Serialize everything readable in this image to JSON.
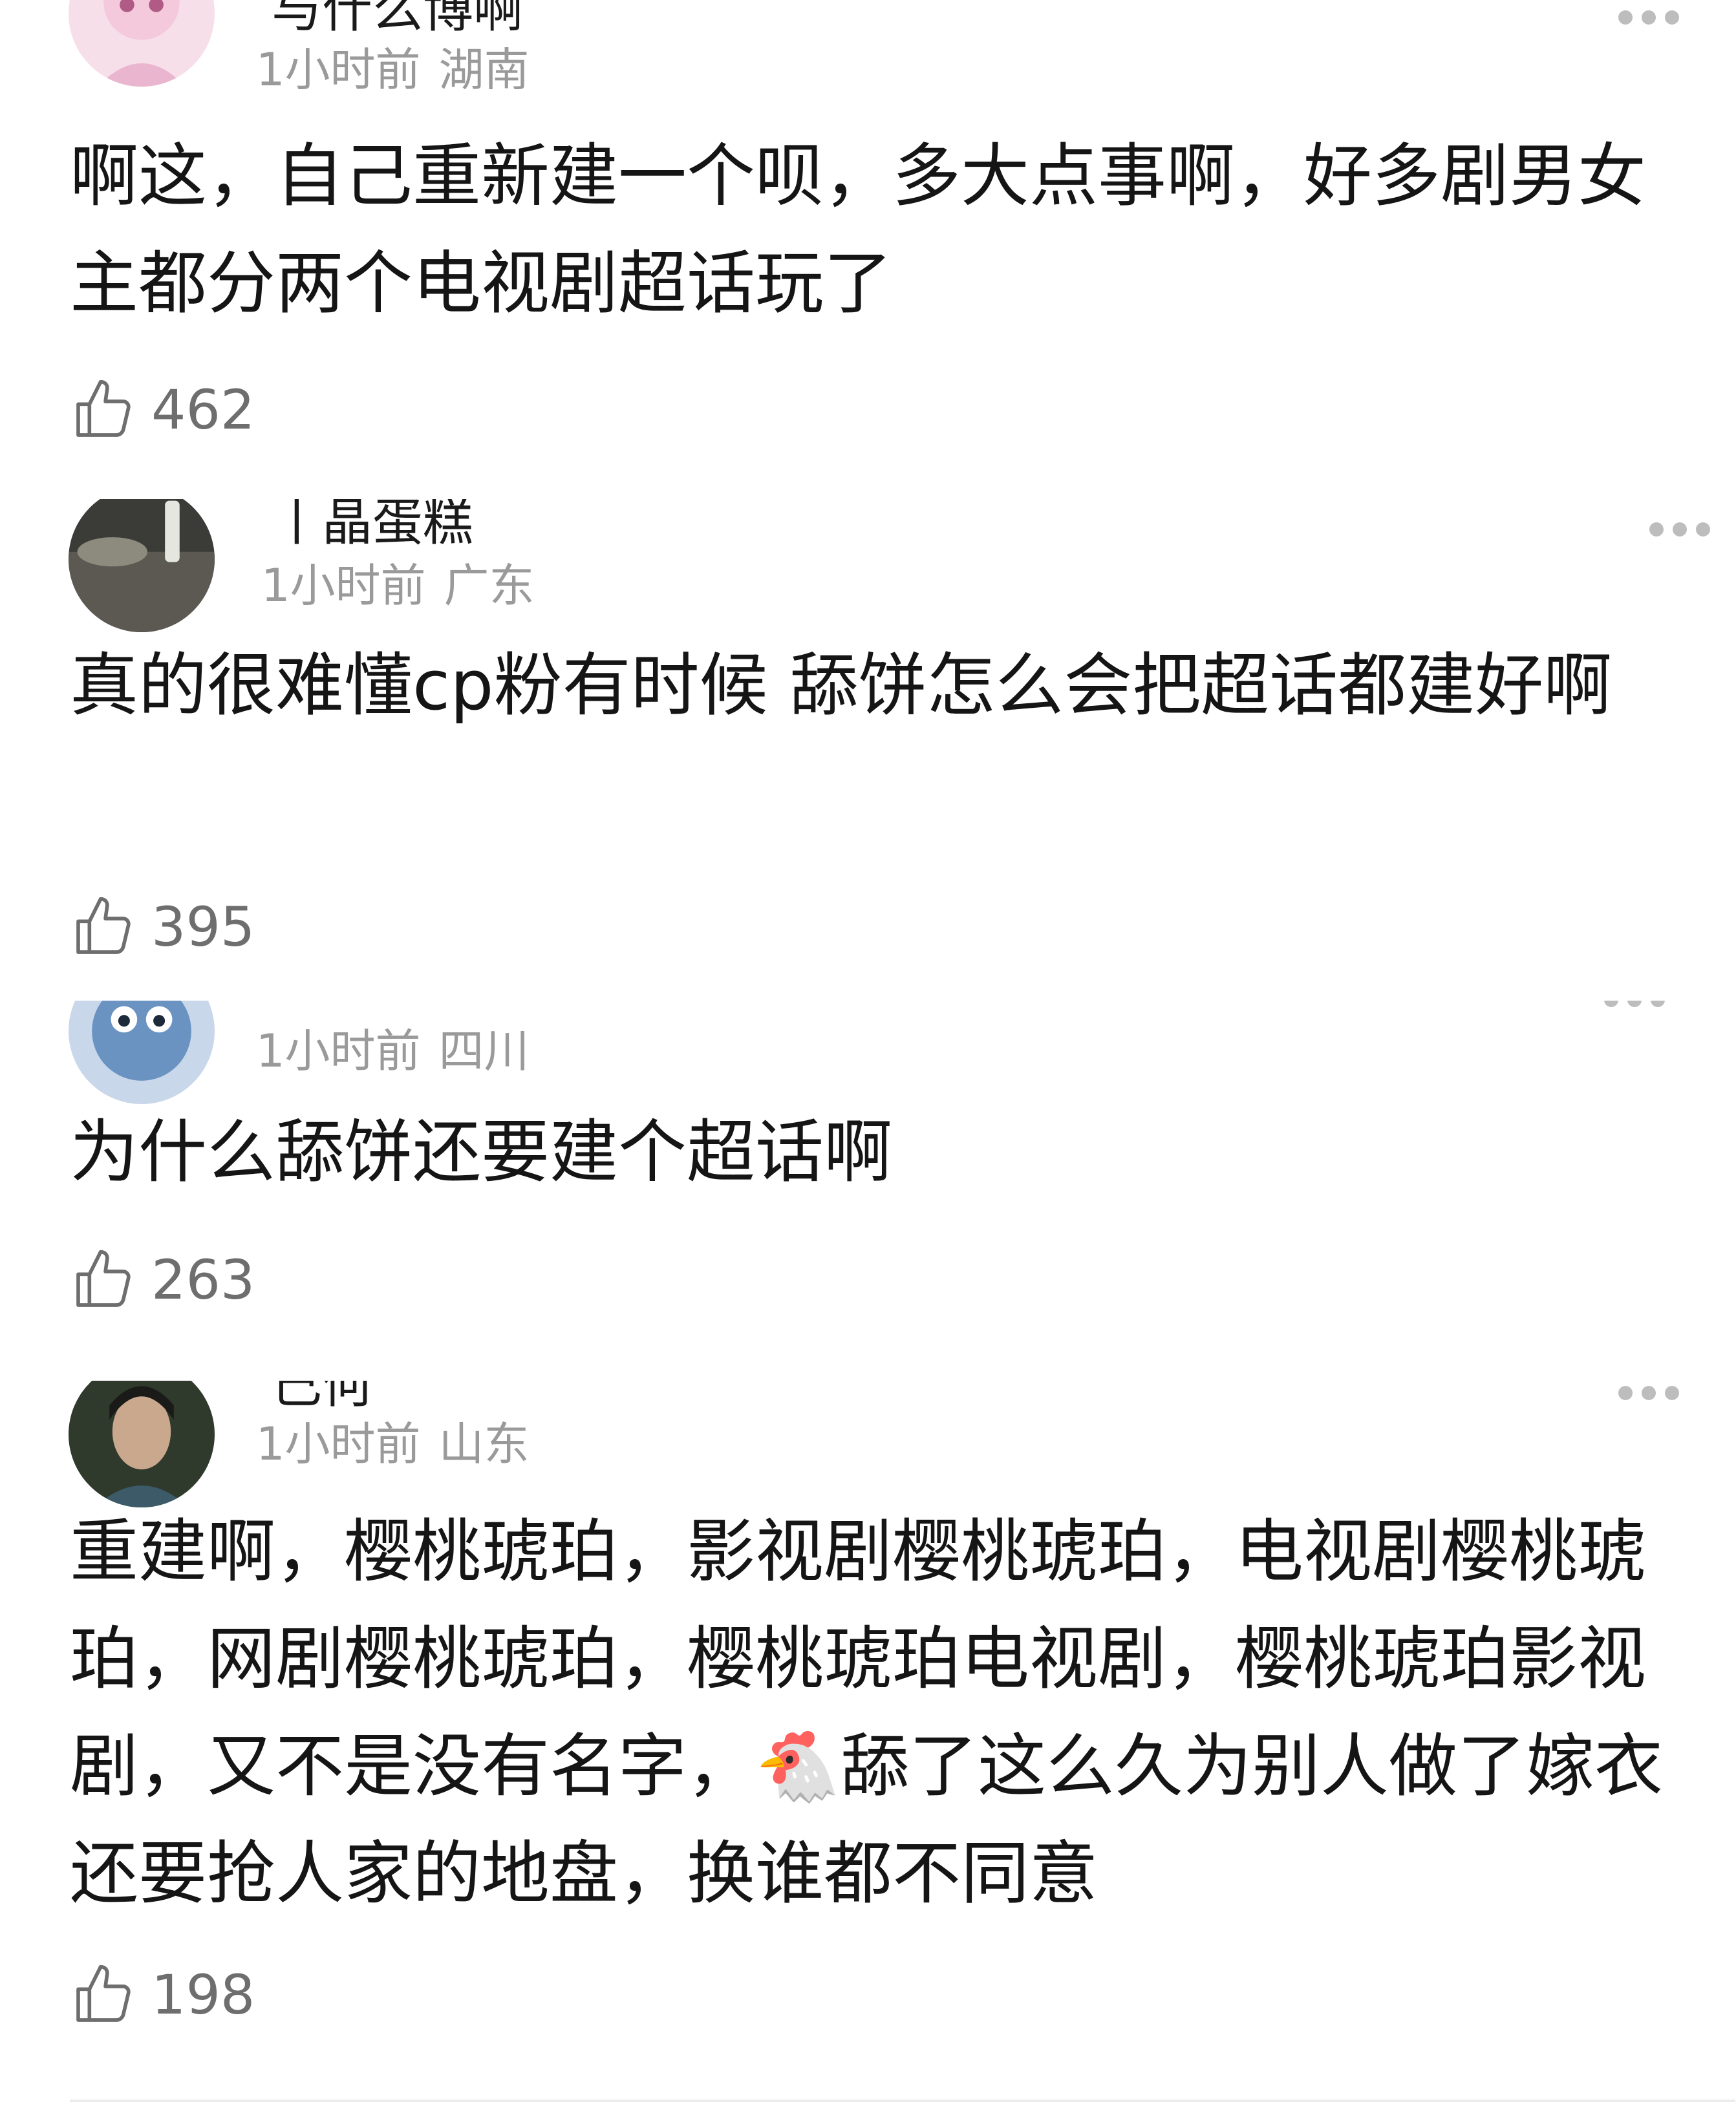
{
  "comments": [
    {
      "username": "与什么博啊",
      "time": "1小时前",
      "location": "湖南",
      "text": "啊这，自己重新建一个呗，多大点事啊，好多剧男女主都分两个电视剧超话玩了",
      "likes": "462",
      "avatar_colors": [
        "#f7dfe9",
        "#eab6cf"
      ]
    },
    {
      "username": "丨晶蛋糕",
      "time": "1小时前",
      "location": "广东",
      "text": "真的很难懂cp粉有时候 舔饼怎么会把超话都建好啊",
      "likes": "395",
      "avatar_colors": [
        "#3b3b38",
        "#8d8a7e"
      ]
    },
    {
      "username": "",
      "time": "1小时前",
      "location": "四川",
      "text": "为什么舔饼还要建个超话啊",
      "likes": "263",
      "avatar_colors": [
        "#6a93c2",
        "#c9d7ea"
      ]
    },
    {
      "username": "己何",
      "time": "1小时前",
      "location": "山东",
      "text": "重建啊，樱桃琥珀，影视剧樱桃琥珀，电视剧樱桃琥珀，网剧樱桃琥珀，樱桃琥珀电视剧，樱桃琥珀影视剧，又不是没有名字，🐔舔了这么久为别人做了嫁衣还要抢人家的地盘，换谁都不同意",
      "likes": "198",
      "avatar_colors": [
        "#2f3a2c",
        "#c9a88e"
      ]
    }
  ],
  "icons": {
    "like": "thumbs-up-icon",
    "more": "more-dots-icon"
  },
  "colors": {
    "meta_text": "#9a9a9a",
    "like_count": "#6e6e6e",
    "divider": "#ececec"
  }
}
